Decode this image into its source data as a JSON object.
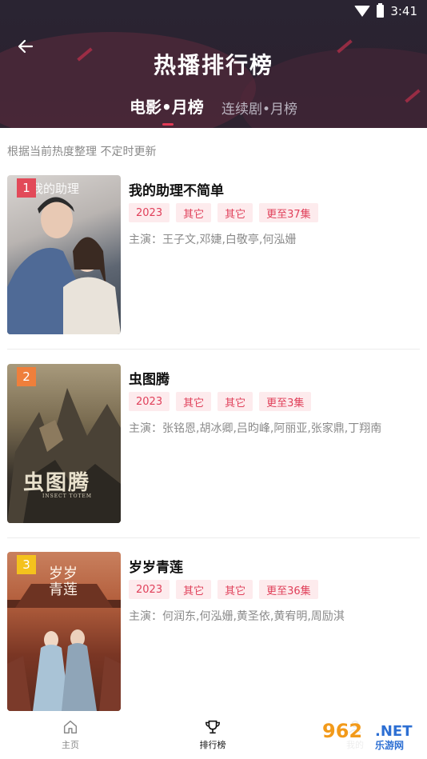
{
  "status_bar": {
    "time": "3:41"
  },
  "header": {
    "title": "热播排行榜",
    "tabs": [
      {
        "label": "电影•月榜",
        "active": true
      },
      {
        "label": "连续剧•月榜",
        "active": false
      }
    ]
  },
  "subtitle": "根据当前热度整理 不定时更新",
  "items": [
    {
      "rank": "1",
      "title": "我的助理不简单",
      "tags": [
        "2023",
        "其它",
        "其它",
        "更至37集"
      ],
      "cast": "主演：王子文,邓婕,白敬亭,何泓姗",
      "poster_colors": [
        "#c7c3c0",
        "#6b6f7a"
      ]
    },
    {
      "rank": "2",
      "title": "虫图腾",
      "tags": [
        "2023",
        "其它",
        "其它",
        "更至3集"
      ],
      "cast": "主演：张铭恩,胡冰卿,吕昀峰,阿丽亚,张家鼎,丁翔南",
      "poster_colors": [
        "#7c6f54",
        "#2c2822"
      ]
    },
    {
      "rank": "3",
      "title": "岁岁青莲",
      "tags": [
        "2023",
        "其它",
        "其它",
        "更至36集"
      ],
      "cast": "主演：何润东,何泓姗,黄圣依,黄宥明,周励淇",
      "poster_colors": [
        "#b4603e",
        "#5d2a1e"
      ]
    }
  ],
  "bottom_nav": [
    {
      "label": "主页",
      "icon": "home-icon",
      "active": false
    },
    {
      "label": "排行榜",
      "icon": "trophy-icon",
      "active": true
    },
    {
      "label": "我的",
      "icon": "user-icon",
      "active": false
    }
  ],
  "watermark": {
    "number": "962",
    "domain": ".NET",
    "name": "乐游网"
  },
  "colors": {
    "accent": "#e23a55",
    "tag_bg": "#fdebed",
    "tag_text": "#e0405a"
  }
}
